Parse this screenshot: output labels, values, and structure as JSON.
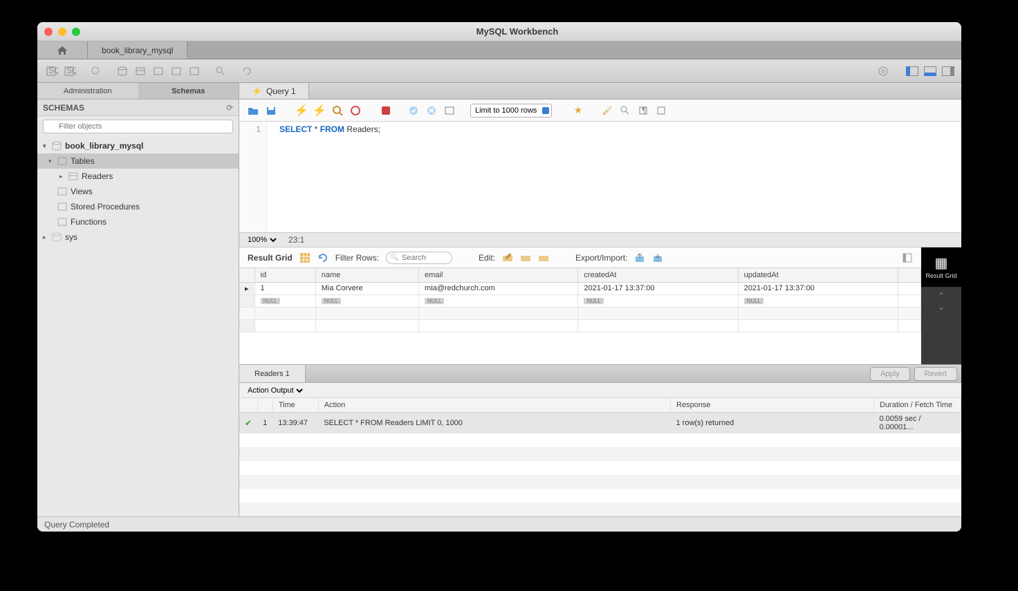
{
  "title": "MySQL Workbench",
  "toptabs": {
    "connection": "book_library_mysql"
  },
  "sidebar": {
    "tabs": {
      "admin": "Administration",
      "schemas": "Schemas"
    },
    "header": "SCHEMAS",
    "filter_placeholder": "Filter objects",
    "tree": {
      "db": "book_library_mysql",
      "tables": "Tables",
      "readers": "Readers",
      "views": "Views",
      "procs": "Stored Procedures",
      "funcs": "Functions",
      "sys": "sys"
    }
  },
  "query": {
    "tab": "Query 1",
    "limit": "Limit to 1000 rows",
    "line_num": "1",
    "sql_kw1": "SELECT",
    "sql_star": " * ",
    "sql_kw2": "FROM",
    "sql_rest": " Readers;",
    "zoom": "100%",
    "cursor": "23:1"
  },
  "result": {
    "grid_label": "Result Grid",
    "filter_label": "Filter Rows:",
    "search_placeholder": "Search",
    "edit_label": "Edit:",
    "export_label": "Export/Import:",
    "columns": [
      "id",
      "name",
      "email",
      "createdAt",
      "updatedAt"
    ],
    "row": {
      "id": "1",
      "name": "Mia Corvere",
      "email": "mia@redchurch.com",
      "createdAt": "2021-01-17 13:37:00",
      "updatedAt": "2021-01-17 13:37:00"
    },
    "null": "NULL",
    "tab": "Readers 1",
    "apply": "Apply",
    "revert": "Revert",
    "sidebar": {
      "grid": "Result Grid"
    }
  },
  "output": {
    "selector": "Action Output",
    "columns": {
      "time": "Time",
      "action": "Action",
      "response": "Response",
      "duration": "Duration / Fetch Time"
    },
    "row": {
      "num": "1",
      "time": "13:39:47",
      "action": "SELECT * FROM Readers LIMIT 0, 1000",
      "response": "1 row(s) returned",
      "duration": "0.0059 sec / 0.00001..."
    }
  },
  "footer": "Query Completed"
}
